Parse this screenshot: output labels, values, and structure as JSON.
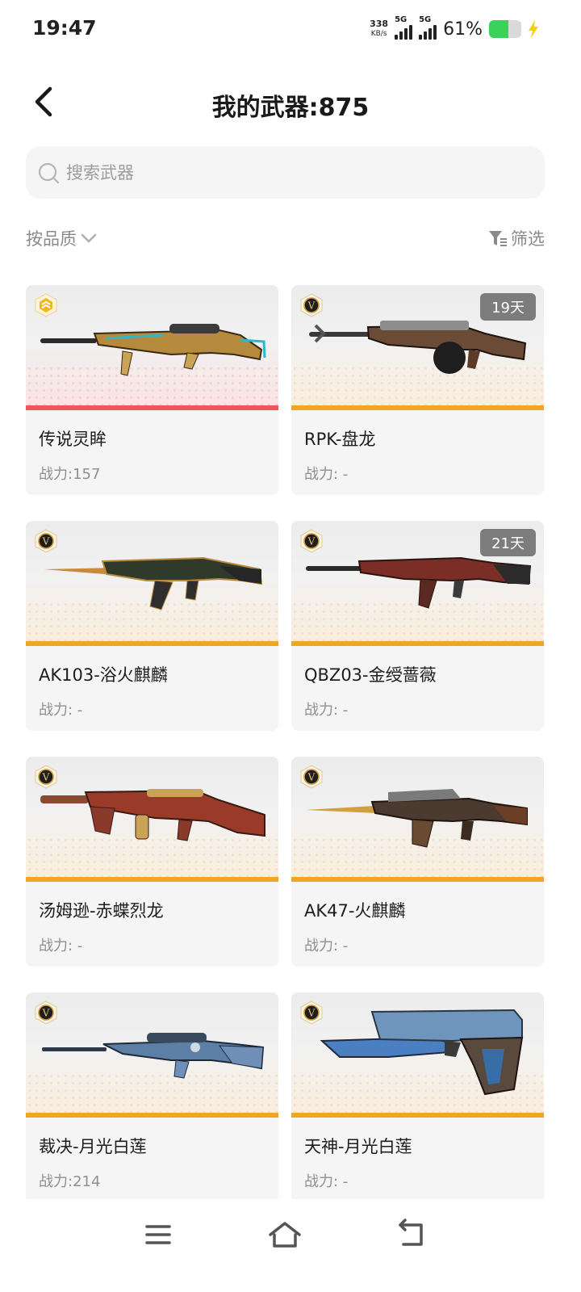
{
  "status_bar": {
    "time": "19:47",
    "net_speed_value": "338",
    "net_speed_unit": "KB/s",
    "sim1_label": "5G",
    "sim2_label": "5G",
    "battery_percent_text": "61%",
    "battery_level": 0.61,
    "battery_color": "#3ad25a",
    "charging_color": "#f2d200"
  },
  "header": {
    "back_icon": "chevron-left-icon",
    "title": "我的武器:875"
  },
  "search": {
    "placeholder": "搜索武器",
    "value": ""
  },
  "filters": {
    "sort_label": "按品质",
    "filter_label": "筛选"
  },
  "weapons": [
    {
      "name": "传说灵眸",
      "power": "战力:157",
      "timer": "",
      "rarity": "legend"
    },
    {
      "name": "RPK-盘龙",
      "power": "战力: -",
      "timer": "19天",
      "rarity": "v"
    },
    {
      "name": "AK103-浴火麒麟",
      "power": "战力: -",
      "timer": "",
      "rarity": "v"
    },
    {
      "name": "QBZ03-金绶蔷薇",
      "power": "战力: -",
      "timer": "21天",
      "rarity": "v"
    },
    {
      "name": "汤姆逊-赤蝶烈龙",
      "power": "战力: -",
      "timer": "",
      "rarity": "v"
    },
    {
      "name": "AK47-火麒麟",
      "power": "战力: -",
      "timer": "",
      "rarity": "v"
    },
    {
      "name": "裁决-月光白莲",
      "power": "战力:214",
      "timer": "",
      "rarity": "v"
    },
    {
      "name": "天神-月光白莲",
      "power": "战力: -",
      "timer": "",
      "rarity": "v"
    }
  ],
  "colors": {
    "legend_stripe": "#ec5858",
    "v_stripe": "#f2a425",
    "timer_badge": "#7c7c7c"
  },
  "nav": {
    "menu_icon": "menu-icon",
    "home_icon": "home-icon",
    "back_icon": "back-icon"
  }
}
